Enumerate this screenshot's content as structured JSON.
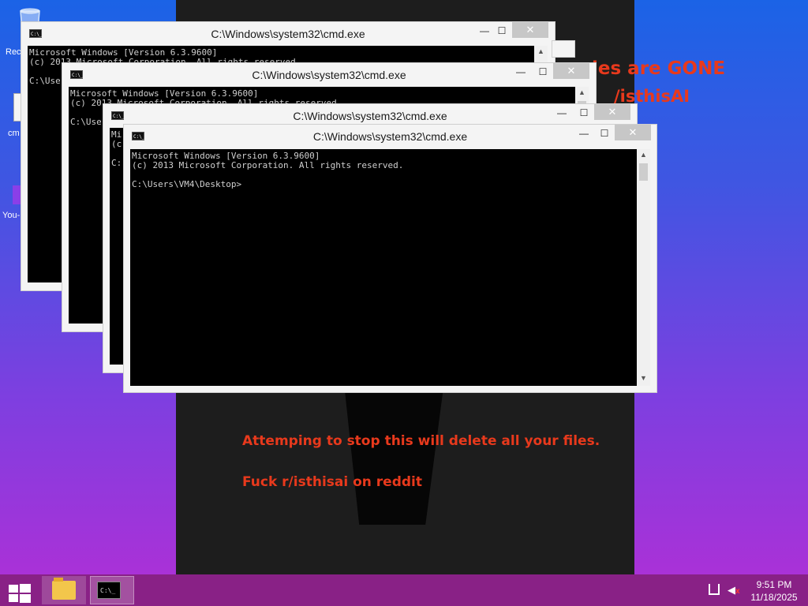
{
  "desktop": {
    "icons": [
      {
        "label": "Rec",
        "icon": "recycle-bin-icon"
      },
      {
        "label": "cm",
        "icon": "cmd-file-icon"
      },
      {
        "label": "You-",
        "icon": "app-file-icon"
      }
    ],
    "wallpaper": {
      "line1": "Attemping to stop this will delete all your files.",
      "line2": "Fuck r/isthisai on reddit",
      "partial_top1": "les are GONE",
      "partial_top2": "/isthisAI",
      "text_color": "#e8391c"
    }
  },
  "windows": [
    {
      "title": "C:\\Windows\\system32\\cmd.exe",
      "lines": [
        "Microsoft Windows [Version 6.3.9600]",
        "(c) 2013 Microsoft Corporation. All rights reserved.",
        "",
        "C:\\Use"
      ]
    },
    {
      "title": "C:\\Windows\\system32\\cmd.exe",
      "lines": [
        "Microsoft Windows [Version 6.3.9600]",
        "(c) 2013 Microsoft Corporation. All rights reserved.",
        "",
        "C:\\Use"
      ]
    },
    {
      "title": "C:\\Windows\\system32\\cmd.exe",
      "lines": [
        "Mi",
        "(c",
        "",
        "C:"
      ]
    },
    {
      "title": "C:\\Windows\\system32\\cmd.exe",
      "lines": [
        "Microsoft Windows [Version 6.3.9600]",
        "(c) 2013 Microsoft Corporation. All rights reserved.",
        "",
        "C:\\Users\\VM4\\Desktop>"
      ]
    }
  ],
  "window_controls": {
    "minimize": "—",
    "maximize": "☐",
    "close": "✕"
  },
  "taskbar": {
    "pinned": [
      {
        "name": "File Explorer",
        "icon": "folder-icon"
      },
      {
        "name": "Command Prompt",
        "icon": "cmd-icon",
        "glyph": "C:\\_"
      }
    ],
    "clock": {
      "time": "9:51 PM",
      "date": "11/18/2025"
    },
    "tray": {
      "volume_muted_mark": "x"
    }
  }
}
